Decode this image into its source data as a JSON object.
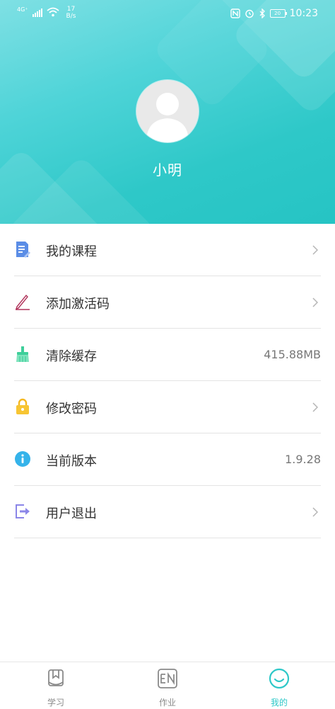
{
  "status_bar": {
    "network": "4G⁺",
    "speed_value": "17",
    "speed_unit": "B/s",
    "battery": "20",
    "time": "10:23"
  },
  "profile": {
    "username": "小明"
  },
  "menu": {
    "items": [
      {
        "label": "我的课程",
        "icon": "course-list-icon"
      },
      {
        "label": "添加激活码",
        "icon": "pen-icon"
      },
      {
        "label": "清除缓存",
        "icon": "broom-icon",
        "value": "415.88MB"
      },
      {
        "label": "修改密码",
        "icon": "lock-icon"
      },
      {
        "label": "当前版本",
        "icon": "info-icon",
        "value": "1.9.28"
      },
      {
        "label": "用户退出",
        "icon": "logout-icon"
      }
    ]
  },
  "tabbar": {
    "tabs": [
      {
        "label": "学习",
        "icon": "book-icon",
        "active": false
      },
      {
        "label": "作业",
        "icon": "en-icon",
        "active": false
      },
      {
        "label": "我的",
        "icon": "smile-icon",
        "active": true
      }
    ]
  },
  "colors": {
    "accent": "#2ec8c8",
    "header_start": "#7fe0e4",
    "header_end": "#26c4c4"
  }
}
